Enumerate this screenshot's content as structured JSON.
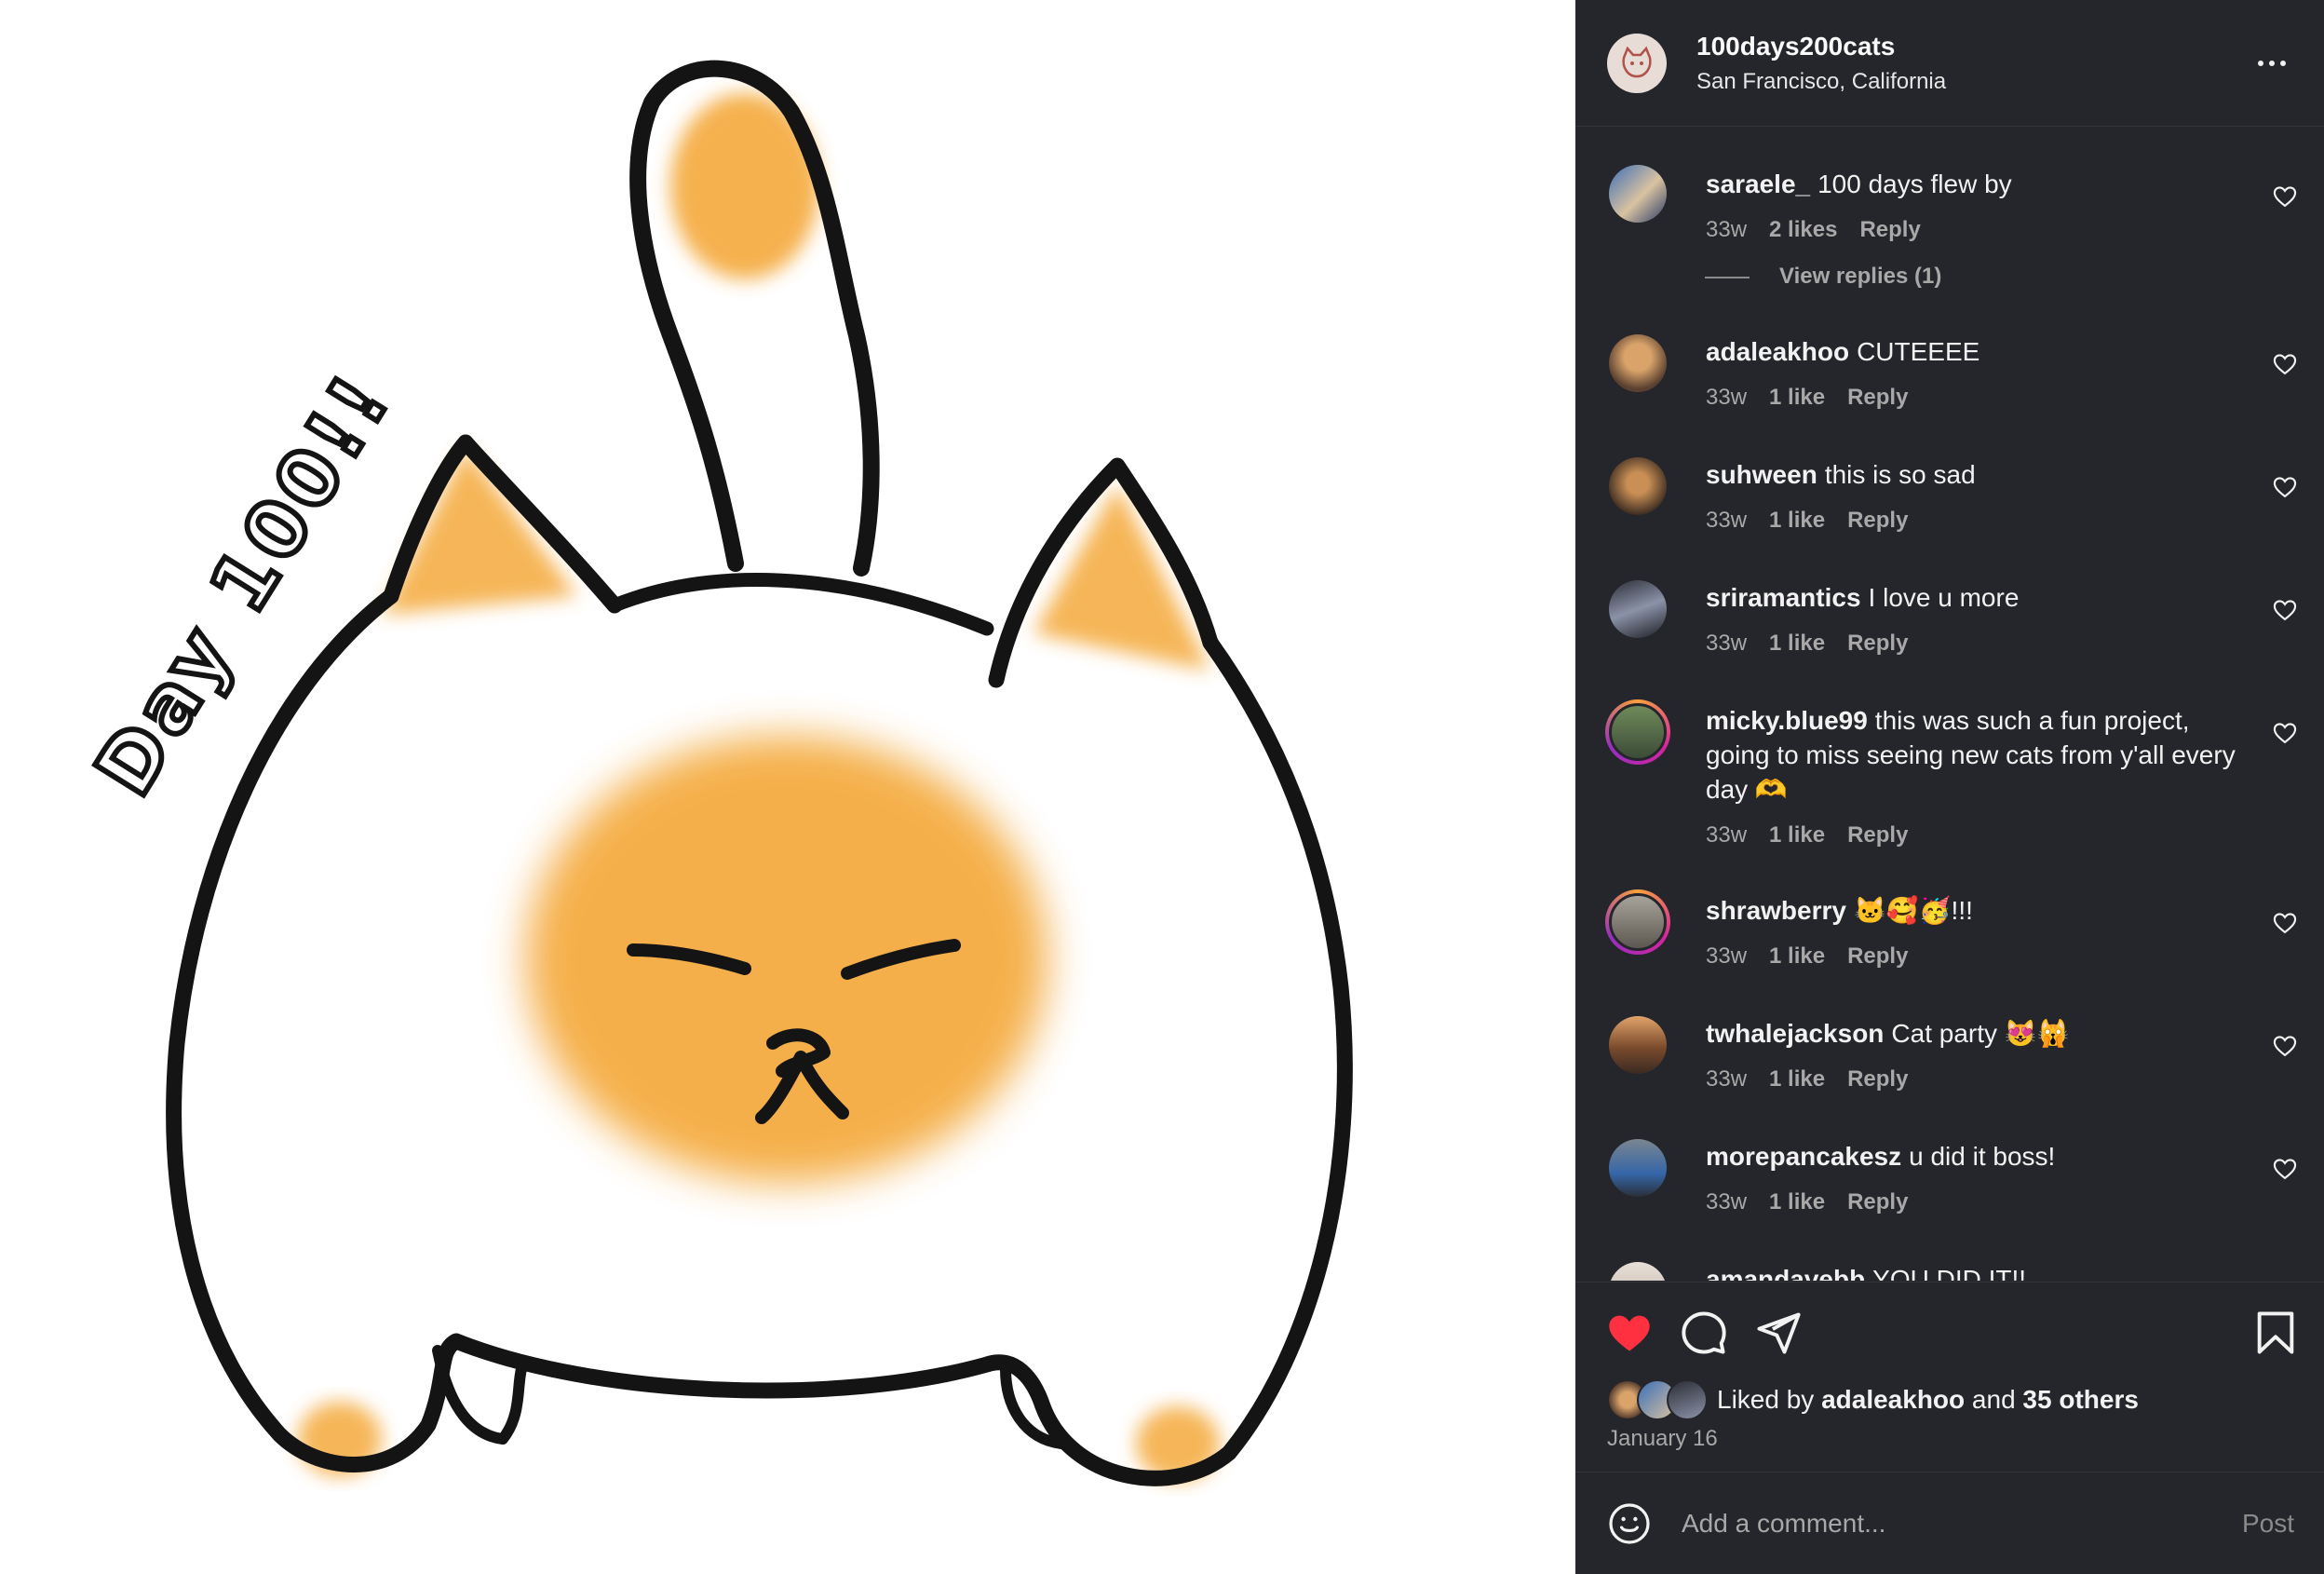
{
  "image": {
    "handwritten_text": "Day 100!!",
    "colors": {
      "outline": "#141414",
      "fur_orange": "#f4a93a",
      "background": "#ffffff"
    }
  },
  "header": {
    "username": "100days200cats",
    "location": "San Francisco, California",
    "more_icon": "more-horizontal-icon"
  },
  "comments": [
    {
      "user": "saraele_",
      "text": "100 days flew by",
      "age": "33w",
      "likes": "2 likes",
      "reply": "Reply",
      "view_replies": "View replies (1)"
    },
    {
      "user": "adaleakhoo",
      "text": "CUTEEEE",
      "age": "33w",
      "likes": "1 like",
      "reply": "Reply"
    },
    {
      "user": "suhween",
      "text": "this is so sad",
      "age": "33w",
      "likes": "1 like",
      "reply": "Reply"
    },
    {
      "user": "sriramantics",
      "text": "I love u more",
      "age": "33w",
      "likes": "1 like",
      "reply": "Reply"
    },
    {
      "user": "micky.blue99",
      "text": "this was such a fun project, going to miss seeing new cats from y'all every day 🫶",
      "age": "33w",
      "likes": "1 like",
      "reply": "Reply"
    },
    {
      "user": "shrawberry",
      "text": "🐱🥰🥳!!!",
      "age": "33w",
      "likes": "1 like",
      "reply": "Reply"
    },
    {
      "user": "twhalejackson",
      "text": "Cat party 😻🙀",
      "age": "33w",
      "likes": "1 like",
      "reply": "Reply"
    },
    {
      "user": "morepancakesz",
      "text": "u did it boss!",
      "age": "33w",
      "likes": "1 like",
      "reply": "Reply"
    },
    {
      "user": "amandavebb",
      "text": "YOU DID IT!!",
      "age": "",
      "likes": "",
      "reply": ""
    }
  ],
  "actions": {
    "like_color": "#ff3040",
    "liked_by_prefix": "Liked by",
    "liked_by_user": "adaleakhoo",
    "liked_by_and": "and",
    "liked_by_others": "35 others",
    "date": "January 16"
  },
  "comment_box": {
    "placeholder": "Add a comment...",
    "post_label": "Post"
  }
}
